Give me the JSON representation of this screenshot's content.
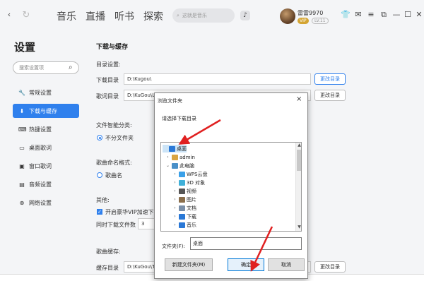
{
  "nav": {
    "tabs": [
      "音乐",
      "直播",
      "听书",
      "探索"
    ],
    "search_placeholder": "这就是音乐"
  },
  "user": {
    "name": "雷雷9970",
    "vip": "VIP",
    "level": "LV.11"
  },
  "sidebar": {
    "title": "设置",
    "search_placeholder": "搜索设置项",
    "items": [
      {
        "label": "常规设置",
        "icon": "wrench-icon"
      },
      {
        "label": "下载与缓存",
        "icon": "download-icon",
        "active": true
      },
      {
        "label": "热键设置",
        "icon": "keyboard-icon"
      },
      {
        "label": "桌面歌词",
        "icon": "monitor-icon"
      },
      {
        "label": "窗口歌词",
        "icon": "window-icon"
      },
      {
        "label": "音频设置",
        "icon": "audio-icon"
      },
      {
        "label": "网络设置",
        "icon": "network-icon"
      }
    ]
  },
  "main": {
    "section_title": "下载与缓存",
    "dir_settings": "目录设置:",
    "download_dir_label": "下载目录",
    "download_dir_value": "D:\\Kugou\\",
    "change_dir": "更改目录",
    "lyrics_dir_label": "歌词目录",
    "lyrics_dir_value": "D:\\KuGou\\Lyric\\",
    "smart_classify": "文件智能分类:",
    "no_subfolder": "不分文件夹",
    "song_naming": "歌曲命名格式:",
    "song_name": "歌曲名",
    "other": "其他:",
    "vip_option": "开启豪华VIP加速下载",
    "concurrent_label": "同时下载文件数",
    "concurrent_value": "3",
    "cache_title": "歌曲缓存:",
    "cache_dir_label": "缓存目录",
    "cache_dir_value": "D:\\KuGou\\Temp\\",
    "cache_change": "更改目录"
  },
  "dialog": {
    "title": "浏览文件夹",
    "close": "×",
    "prompt": "请选择下载目录",
    "tree": [
      {
        "label": "桌面",
        "level": 0,
        "arrow": "",
        "icon_color": "#2a78d6",
        "selected": true
      },
      {
        "label": "admin",
        "level": 1,
        "arrow": "›",
        "icon_color": "#d9a441"
      },
      {
        "label": "此电脑",
        "level": 1,
        "arrow": "⌄",
        "icon_color": "#4a90c8"
      },
      {
        "label": "WPS云盘",
        "level": 2,
        "arrow": "›",
        "icon_color": "#3aa0e8"
      },
      {
        "label": "3D 对象",
        "level": 2,
        "arrow": "›",
        "icon_color": "#40b0d8"
      },
      {
        "label": "视频",
        "level": 2,
        "arrow": "›",
        "icon_color": "#555555"
      },
      {
        "label": "图片",
        "level": 2,
        "arrow": "›",
        "icon_color": "#8a6e4b"
      },
      {
        "label": "文档",
        "level": 2,
        "arrow": "›",
        "icon_color": "#7a8fa8"
      },
      {
        "label": "下载",
        "level": 2,
        "arrow": "›",
        "icon_color": "#2a78d6"
      },
      {
        "label": "音乐",
        "level": 2,
        "arrow": "›",
        "icon_color": "#2a78d6"
      },
      {
        "label": "",
        "level": 2,
        "arrow": "",
        "icon_color": "#2a78d6"
      }
    ],
    "folder_label": "文件夹(F):",
    "folder_value": "桌面",
    "new_folder": "新建文件夹(M)",
    "ok": "确定",
    "cancel": "取消"
  },
  "colors": {
    "accent": "#2f80ed",
    "arrow": "#e02020"
  }
}
